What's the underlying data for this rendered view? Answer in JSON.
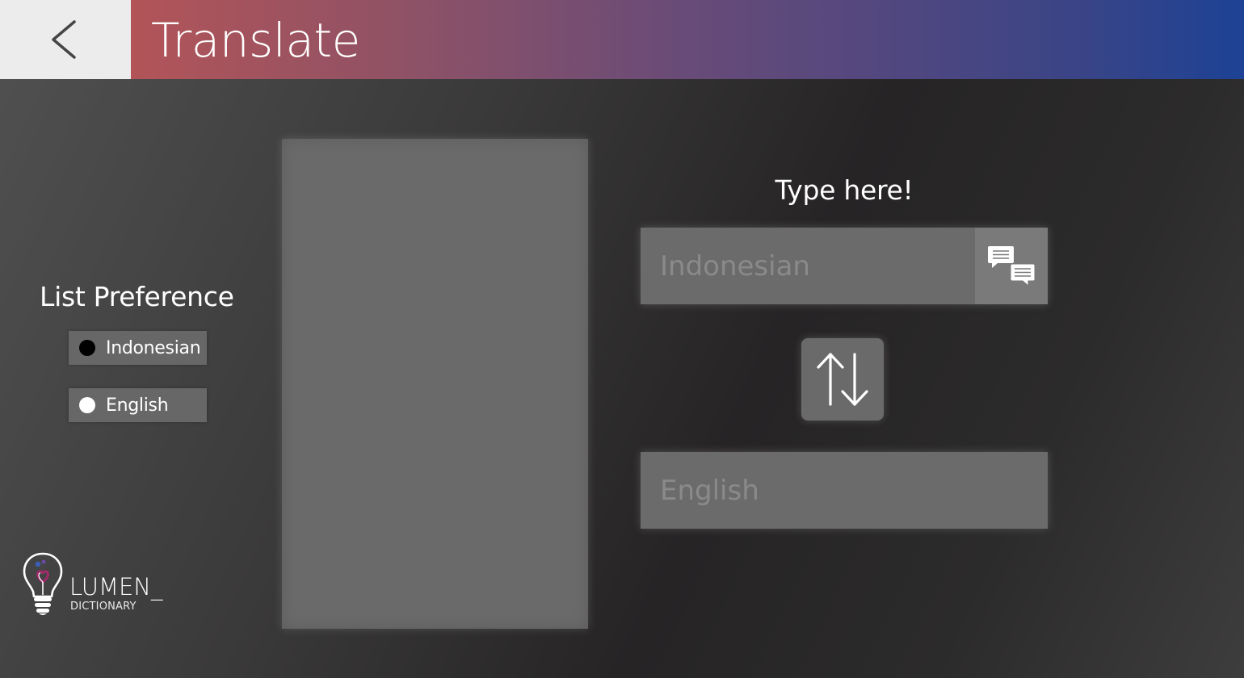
{
  "header": {
    "title": "Translate",
    "back_icon": "chevron-left-icon",
    "gradient_start": "#b25458",
    "gradient_end": "#1d4295"
  },
  "list_preference": {
    "title": "List Preference",
    "options": [
      {
        "label": "Indonesian",
        "selected": true
      },
      {
        "label": "English",
        "selected": false
      }
    ]
  },
  "translator": {
    "prompt": "Type here!",
    "input_placeholder": "Indonesian",
    "translate_icon": "chat-bubbles-icon",
    "swap_icon": "swap-arrows-icon",
    "output_placeholder": "English"
  },
  "logo": {
    "name": "LUMEN_",
    "subtitle": "DICTIONARY",
    "icon": "lightbulb-icon",
    "accent": "#a02a6a"
  }
}
